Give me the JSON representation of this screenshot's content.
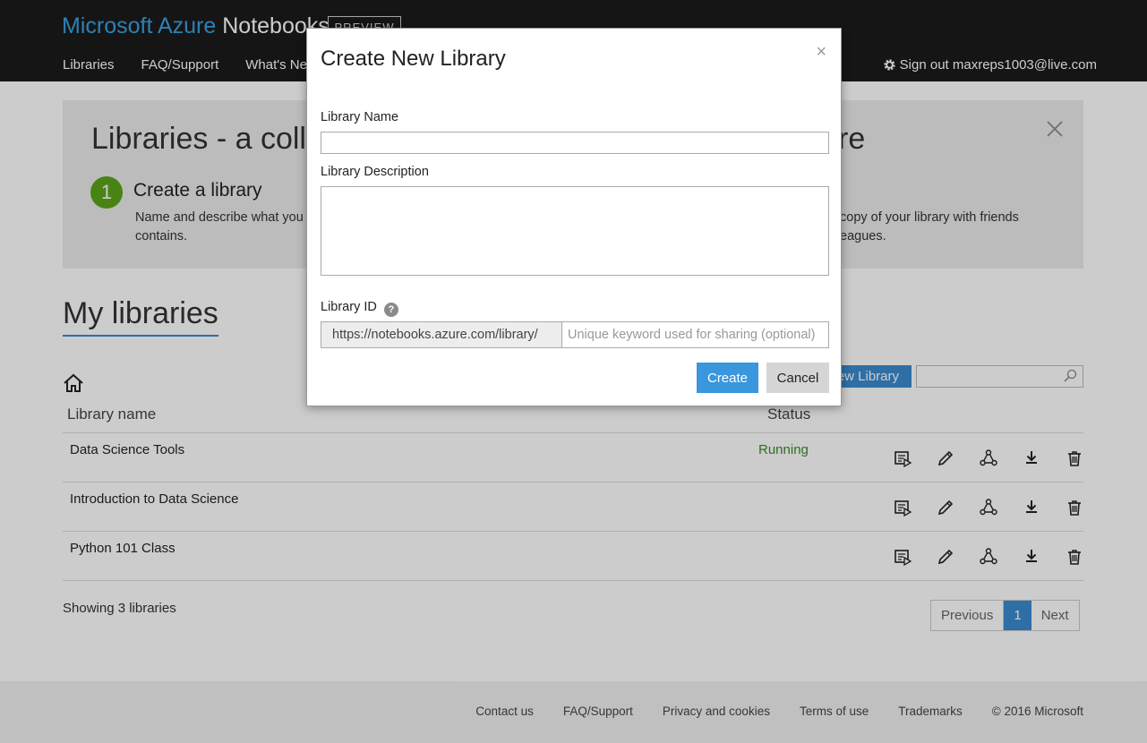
{
  "header": {
    "brand_part1": "Microsoft Azure",
    "brand_part2": "Notebooks",
    "preview_badge": "PREVIEW",
    "nav": [
      {
        "label": "Libraries"
      },
      {
        "label": "FAQ/Support"
      },
      {
        "label": "What's Ne"
      }
    ],
    "signout": "Sign out maxreps1003@live.com"
  },
  "banner": {
    "title_left": "Libraries - a colle",
    "title_right": "re",
    "step1_number": "1",
    "step1_title": "Create a library",
    "step1_text": "Name and describe what you\ncontains.",
    "step3_text": "copy of your library with friends\neagues."
  },
  "main": {
    "section_title": "My libraries",
    "new_library_label": "ew Library",
    "table_headers": {
      "name": "Library name",
      "status": "Status"
    },
    "rows": [
      {
        "name": "Data Science Tools",
        "status": "Running"
      },
      {
        "name": "Introduction to Data Science",
        "status": ""
      },
      {
        "name": "Python 101 Class",
        "status": ""
      }
    ],
    "showing": "Showing 3 libraries",
    "pager": {
      "previous": "Previous",
      "current": "1",
      "next": "Next"
    }
  },
  "footer": {
    "links": [
      "Contact us",
      "FAQ/Support",
      "Privacy and cookies",
      "Terms of use",
      "Trademarks"
    ],
    "copyright": "© 2016 Microsoft"
  },
  "modal": {
    "title": "Create New Library",
    "close_glyph": "×",
    "name_label": "Library Name",
    "name_value": "",
    "description_label": "Library Description",
    "description_value": "",
    "id_label": "Library ID",
    "id_help_glyph": "?",
    "id_prefix": "https://notebooks.azure.com/library/",
    "id_placeholder": "Unique keyword used for sharing (optional)",
    "create_label": "Create",
    "cancel_label": "Cancel"
  },
  "colors": {
    "header_bg": "#1b1b1b",
    "brand_accent": "#3aa0e0",
    "primary_button": "#3a96dd",
    "status_running": "#3a8a2a",
    "step_badge": "#5aa61a"
  },
  "icons": {
    "row_actions": [
      "run-icon",
      "edit-pencil-icon",
      "share-icon",
      "download-icon",
      "delete-trash-icon"
    ],
    "other": [
      "gear-icon",
      "home-icon",
      "search-icon",
      "close-icon",
      "help-icon"
    ]
  }
}
